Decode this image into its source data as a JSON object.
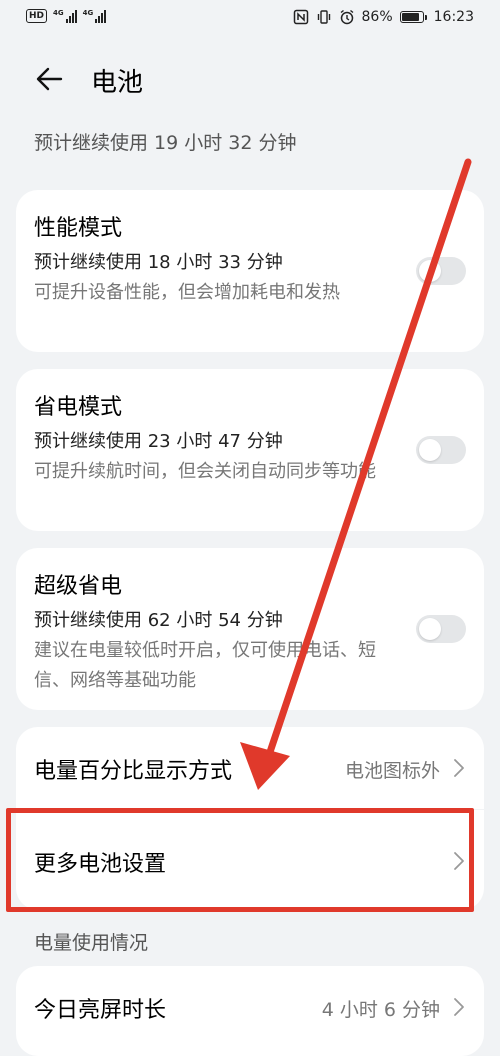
{
  "status_bar": {
    "hd_label": "HD",
    "sim1": "1",
    "net1": "4G",
    "net2": "4G",
    "battery_percent": "86%",
    "battery_level": 0.86,
    "time": "16:23"
  },
  "header": {
    "title": "电池"
  },
  "summary": "预计继续使用 19 小时 32 分钟",
  "modes": [
    {
      "title": "性能模式",
      "estimate": "预计继续使用 18 小时 33 分钟",
      "description": "可提升设备性能，但会增加耗电和发热",
      "enabled": false
    },
    {
      "title": "省电模式",
      "estimate": "预计继续使用 23 小时 47 分钟",
      "description": "可提升续航时间，但会关闭自动同步等功能",
      "enabled": false
    },
    {
      "title": "超级省电",
      "estimate": "预计继续使用 62 小时 54 分钟",
      "description": "建议在电量较低时开启，仅可使用电话、短信、网络等基础功能",
      "enabled": false
    }
  ],
  "percentage_display": {
    "label": "电量百分比显示方式",
    "value": "电池图标外"
  },
  "more_settings": {
    "label": "更多电池设置"
  },
  "usage_section": {
    "header": "电量使用情况",
    "screen_time_label": "今日亮屏时长",
    "screen_time_value": "4 小时 6 分钟"
  },
  "colors": {
    "annotation_red": "#e0392b",
    "background": "#f1f3f5",
    "card": "#ffffff"
  }
}
